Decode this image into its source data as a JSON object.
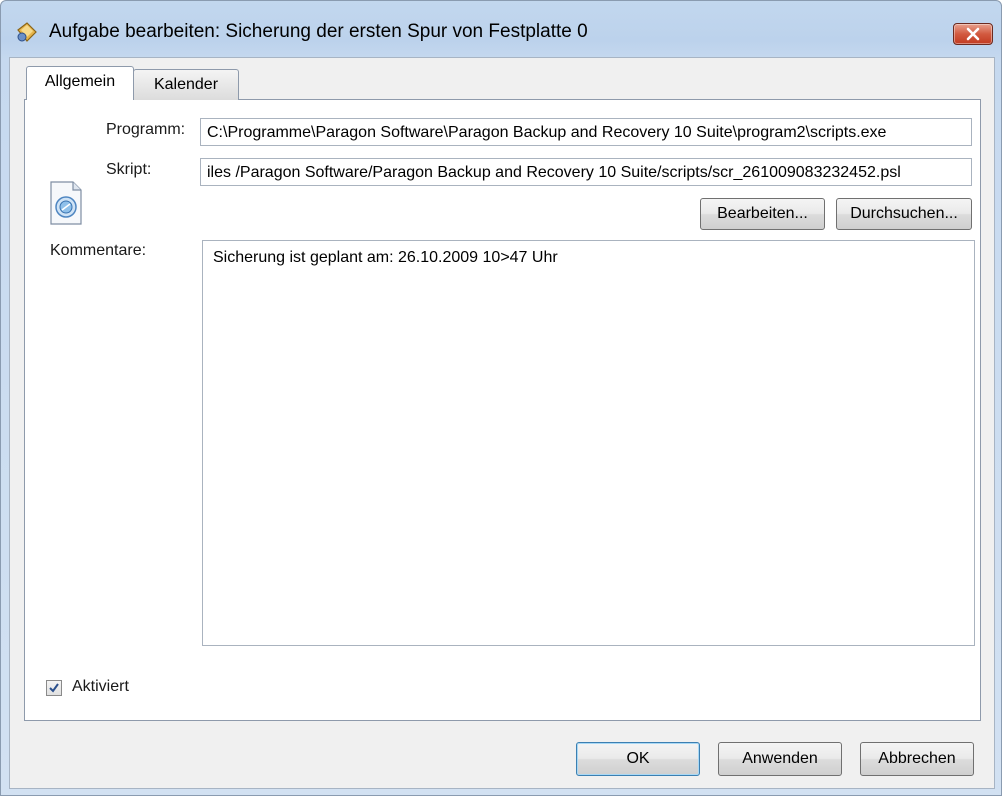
{
  "window": {
    "title": "Aufgabe bearbeiten: Sicherung der ersten Spur von Festplatte 0",
    "title_icon": "task-edit-icon",
    "close_icon": "close-icon"
  },
  "tabs": [
    {
      "label": "Allgemein",
      "active": true
    },
    {
      "label": "Kalender",
      "active": false
    }
  ],
  "general": {
    "program_label": "Programm:",
    "program_value": "C:\\Programme\\Paragon Software\\Paragon Backup and Recovery 10 Suite\\program2\\scripts.exe",
    "script_label": "Skript:",
    "script_value": "iles /Paragon Software/Paragon Backup and Recovery 10 Suite/scripts/scr_261009083232452.psl",
    "script_icon": "script-file-icon",
    "edit_label": "Bearbeiten...",
    "browse_label": "Durchsuchen...",
    "comments_label": "Kommentare:",
    "comments_value": "Sicherung ist geplant am: 26.10.2009 10>47 Uhr",
    "activated_label": "Aktiviert",
    "activated_checked": true
  },
  "footer": {
    "ok_label": "OK",
    "apply_label": "Anwenden",
    "cancel_label": "Abbrechen"
  },
  "colors": {
    "titlebar": "#bcd2ec",
    "close_button": "#d25a40",
    "panel_background": "#ffffff",
    "dialog_background": "#f0f0f0"
  }
}
